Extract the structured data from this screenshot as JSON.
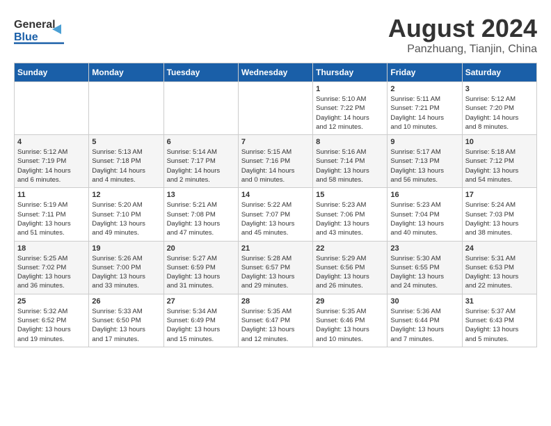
{
  "header": {
    "logo_general": "General",
    "logo_blue": "Blue",
    "month_title": "August 2024",
    "subtitle": "Panzhuang, Tianjin, China"
  },
  "weekdays": [
    "Sunday",
    "Monday",
    "Tuesday",
    "Wednesday",
    "Thursday",
    "Friday",
    "Saturday"
  ],
  "weeks": [
    [
      {
        "day": "",
        "info": ""
      },
      {
        "day": "",
        "info": ""
      },
      {
        "day": "",
        "info": ""
      },
      {
        "day": "",
        "info": ""
      },
      {
        "day": "1",
        "info": "Sunrise: 5:10 AM\nSunset: 7:22 PM\nDaylight: 14 hours\nand 12 minutes."
      },
      {
        "day": "2",
        "info": "Sunrise: 5:11 AM\nSunset: 7:21 PM\nDaylight: 14 hours\nand 10 minutes."
      },
      {
        "day": "3",
        "info": "Sunrise: 5:12 AM\nSunset: 7:20 PM\nDaylight: 14 hours\nand 8 minutes."
      }
    ],
    [
      {
        "day": "4",
        "info": "Sunrise: 5:12 AM\nSunset: 7:19 PM\nDaylight: 14 hours\nand 6 minutes."
      },
      {
        "day": "5",
        "info": "Sunrise: 5:13 AM\nSunset: 7:18 PM\nDaylight: 14 hours\nand 4 minutes."
      },
      {
        "day": "6",
        "info": "Sunrise: 5:14 AM\nSunset: 7:17 PM\nDaylight: 14 hours\nand 2 minutes."
      },
      {
        "day": "7",
        "info": "Sunrise: 5:15 AM\nSunset: 7:16 PM\nDaylight: 14 hours\nand 0 minutes."
      },
      {
        "day": "8",
        "info": "Sunrise: 5:16 AM\nSunset: 7:14 PM\nDaylight: 13 hours\nand 58 minutes."
      },
      {
        "day": "9",
        "info": "Sunrise: 5:17 AM\nSunset: 7:13 PM\nDaylight: 13 hours\nand 56 minutes."
      },
      {
        "day": "10",
        "info": "Sunrise: 5:18 AM\nSunset: 7:12 PM\nDaylight: 13 hours\nand 54 minutes."
      }
    ],
    [
      {
        "day": "11",
        "info": "Sunrise: 5:19 AM\nSunset: 7:11 PM\nDaylight: 13 hours\nand 51 minutes."
      },
      {
        "day": "12",
        "info": "Sunrise: 5:20 AM\nSunset: 7:10 PM\nDaylight: 13 hours\nand 49 minutes."
      },
      {
        "day": "13",
        "info": "Sunrise: 5:21 AM\nSunset: 7:08 PM\nDaylight: 13 hours\nand 47 minutes."
      },
      {
        "day": "14",
        "info": "Sunrise: 5:22 AM\nSunset: 7:07 PM\nDaylight: 13 hours\nand 45 minutes."
      },
      {
        "day": "15",
        "info": "Sunrise: 5:23 AM\nSunset: 7:06 PM\nDaylight: 13 hours\nand 43 minutes."
      },
      {
        "day": "16",
        "info": "Sunrise: 5:23 AM\nSunset: 7:04 PM\nDaylight: 13 hours\nand 40 minutes."
      },
      {
        "day": "17",
        "info": "Sunrise: 5:24 AM\nSunset: 7:03 PM\nDaylight: 13 hours\nand 38 minutes."
      }
    ],
    [
      {
        "day": "18",
        "info": "Sunrise: 5:25 AM\nSunset: 7:02 PM\nDaylight: 13 hours\nand 36 minutes."
      },
      {
        "day": "19",
        "info": "Sunrise: 5:26 AM\nSunset: 7:00 PM\nDaylight: 13 hours\nand 33 minutes."
      },
      {
        "day": "20",
        "info": "Sunrise: 5:27 AM\nSunset: 6:59 PM\nDaylight: 13 hours\nand 31 minutes."
      },
      {
        "day": "21",
        "info": "Sunrise: 5:28 AM\nSunset: 6:57 PM\nDaylight: 13 hours\nand 29 minutes."
      },
      {
        "day": "22",
        "info": "Sunrise: 5:29 AM\nSunset: 6:56 PM\nDaylight: 13 hours\nand 26 minutes."
      },
      {
        "day": "23",
        "info": "Sunrise: 5:30 AM\nSunset: 6:55 PM\nDaylight: 13 hours\nand 24 minutes."
      },
      {
        "day": "24",
        "info": "Sunrise: 5:31 AM\nSunset: 6:53 PM\nDaylight: 13 hours\nand 22 minutes."
      }
    ],
    [
      {
        "day": "25",
        "info": "Sunrise: 5:32 AM\nSunset: 6:52 PM\nDaylight: 13 hours\nand 19 minutes."
      },
      {
        "day": "26",
        "info": "Sunrise: 5:33 AM\nSunset: 6:50 PM\nDaylight: 13 hours\nand 17 minutes."
      },
      {
        "day": "27",
        "info": "Sunrise: 5:34 AM\nSunset: 6:49 PM\nDaylight: 13 hours\nand 15 minutes."
      },
      {
        "day": "28",
        "info": "Sunrise: 5:35 AM\nSunset: 6:47 PM\nDaylight: 13 hours\nand 12 minutes."
      },
      {
        "day": "29",
        "info": "Sunrise: 5:35 AM\nSunset: 6:46 PM\nDaylight: 13 hours\nand 10 minutes."
      },
      {
        "day": "30",
        "info": "Sunrise: 5:36 AM\nSunset: 6:44 PM\nDaylight: 13 hours\nand 7 minutes."
      },
      {
        "day": "31",
        "info": "Sunrise: 5:37 AM\nSunset: 6:43 PM\nDaylight: 13 hours\nand 5 minutes."
      }
    ]
  ]
}
